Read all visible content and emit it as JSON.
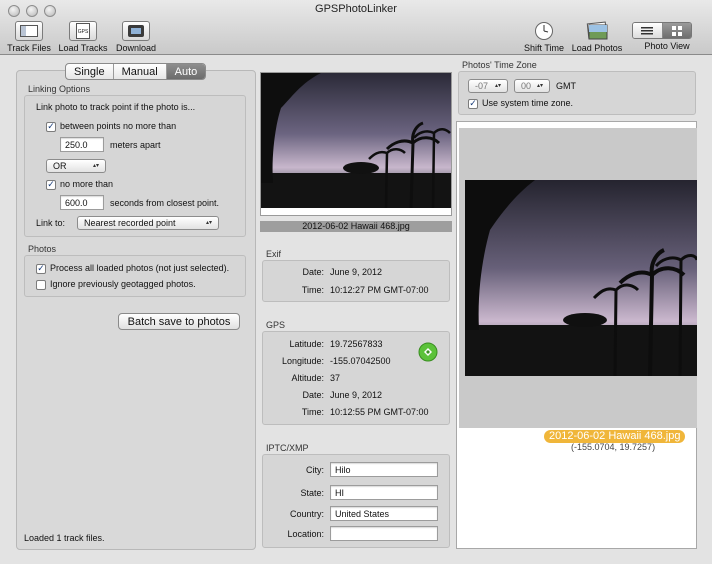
{
  "window": {
    "title": "GPSPhotoLinker"
  },
  "toolbar": {
    "track_files": "Track Files",
    "load_tracks": "Load Tracks",
    "download": "Download",
    "shift_time": "Shift Time",
    "load_photos": "Load Photos",
    "photo_view": "Photo View",
    "gps_glyph": "GPS"
  },
  "mode": {
    "single": "Single",
    "manual": "Manual",
    "auto": "Auto",
    "selected": "Auto"
  },
  "linking": {
    "title": "Linking Options",
    "intro": "Link photo to track point if the photo is...",
    "between_label": "between points no more than",
    "between_checked": true,
    "meters_value": "250.0",
    "meters_label": "meters apart",
    "logic_value": "OR",
    "no_more_label": "no more than",
    "no_more_checked": true,
    "seconds_value": "600.0",
    "seconds_label": "seconds from closest point.",
    "link_to_label": "Link to:",
    "link_to_value": "Nearest recorded point"
  },
  "photos": {
    "title": "Photos",
    "process_all_label": "Process all loaded photos (not just selected).",
    "process_all_checked": true,
    "ignore_label": "Ignore previously geotagged photos.",
    "ignore_checked": false
  },
  "batch_button": "Batch save to photos",
  "status": "Loaded 1 track files.",
  "thumb_caption": "2012-06-02 Hawaii 468.jpg",
  "exif": {
    "title": "Exif",
    "date_label": "Date:",
    "date_value": "June 9, 2012",
    "time_label": "Time:",
    "time_value": "10:12:27 PM GMT-07:00"
  },
  "gps": {
    "title": "GPS",
    "latitude_label": "Latitude:",
    "latitude_value": "19.72567833",
    "longitude_label": "Longitude:",
    "longitude_value": "-155.07042500",
    "altitude_label": "Altitude:",
    "altitude_value": "37",
    "date_label": "Date:",
    "date_value": "June 9, 2012",
    "time_label": "Time:",
    "time_value": "10:12:55 PM GMT-07:00"
  },
  "iptc": {
    "title": "IPTC/XMP",
    "city_label": "City:",
    "city_value": "Hilo",
    "state_label": "State:",
    "state_value": "HI",
    "country_label": "Country:",
    "country_value": "United States",
    "location_label": "Location:",
    "location_value": ""
  },
  "timezone": {
    "title": "Photos' Time Zone",
    "hours_value": "-07",
    "minutes_value": "00",
    "gmt_label": "GMT",
    "use_system_label": "Use system time zone.",
    "use_system_checked": true
  },
  "preview": {
    "caption": "2012-06-02 Hawaii 468.jpg",
    "coordinates": "(-155.0704, 19.7257)"
  },
  "colors": {
    "caption_highlight": "#f0b63a",
    "gps_badge": "#5cc23a",
    "window_bg": "#e3e3e3"
  },
  "icons": {
    "track_files": "sidebar-window-icon",
    "load_tracks": "gps-document-icon",
    "download": "download-device-icon",
    "shift_time": "clock-icon",
    "load_photos": "photo-stack-icon",
    "photo_view_list": "list-view-icon",
    "photo_view_grid": "grid-view-icon",
    "gps_badge": "gps-satellite-badge-icon"
  }
}
